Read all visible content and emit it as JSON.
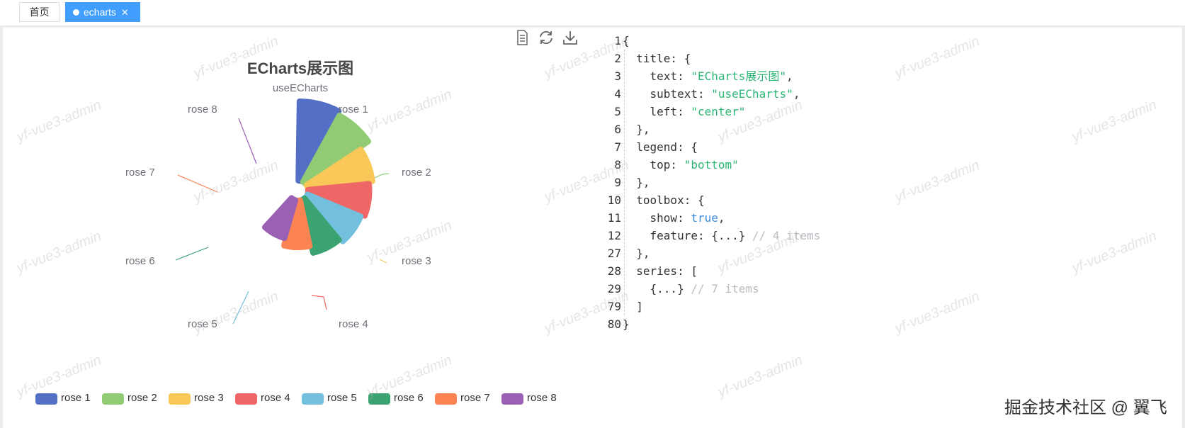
{
  "tabs": [
    {
      "label": "首页",
      "active": false
    },
    {
      "label": "echarts",
      "active": true
    }
  ],
  "chart": {
    "title": "ECharts展示图",
    "subtitle": "useECharts",
    "toolbox": [
      "data-view-icon",
      "restore-icon",
      "save-as-image-icon"
    ]
  },
  "chart_data": {
    "type": "pie",
    "roseType": "radius",
    "title": "ECharts展示图",
    "subtitle": "useECharts",
    "legend_position": "bottom",
    "categories": [
      "rose 1",
      "rose 2",
      "rose 3",
      "rose 4",
      "rose 5",
      "rose 6",
      "rose 7",
      "rose 8"
    ],
    "values": [
      40,
      38,
      32,
      30,
      28,
      26,
      22,
      18
    ],
    "colors": [
      "#5470c6",
      "#91cc75",
      "#fac858",
      "#ee6666",
      "#73c0de",
      "#3ba272",
      "#fc8452",
      "#9a60b4"
    ]
  },
  "code": {
    "lines": [
      {
        "num": "1",
        "tokens": [
          {
            "t": "{",
            "c": "key"
          }
        ],
        "indent": 0
      },
      {
        "num": "2",
        "tokens": [
          {
            "t": "title: {",
            "c": "key"
          }
        ],
        "indent": 1
      },
      {
        "num": "3",
        "tokens": [
          {
            "t": "text: ",
            "c": "key"
          },
          {
            "t": "\"ECharts展示图\"",
            "c": "str"
          },
          {
            "t": ",",
            "c": "key"
          }
        ],
        "indent": 2
      },
      {
        "num": "4",
        "tokens": [
          {
            "t": "subtext: ",
            "c": "key"
          },
          {
            "t": "\"useECharts\"",
            "c": "str"
          },
          {
            "t": ",",
            "c": "key"
          }
        ],
        "indent": 2
      },
      {
        "num": "5",
        "tokens": [
          {
            "t": "left: ",
            "c": "key"
          },
          {
            "t": "\"center\"",
            "c": "str"
          }
        ],
        "indent": 2
      },
      {
        "num": "6",
        "tokens": [
          {
            "t": "},",
            "c": "key"
          }
        ],
        "indent": 1
      },
      {
        "num": "7",
        "tokens": [
          {
            "t": "legend: {",
            "c": "key"
          }
        ],
        "indent": 1
      },
      {
        "num": "8",
        "tokens": [
          {
            "t": "top: ",
            "c": "key"
          },
          {
            "t": "\"bottom\"",
            "c": "str"
          }
        ],
        "indent": 2
      },
      {
        "num": "9",
        "tokens": [
          {
            "t": "},",
            "c": "key"
          }
        ],
        "indent": 1
      },
      {
        "num": "10",
        "tokens": [
          {
            "t": "toolbox: {",
            "c": "key"
          }
        ],
        "indent": 1
      },
      {
        "num": "11",
        "tokens": [
          {
            "t": "show: ",
            "c": "key"
          },
          {
            "t": "true",
            "c": "bool"
          },
          {
            "t": ",",
            "c": "key"
          }
        ],
        "indent": 2
      },
      {
        "num": "12",
        "tokens": [
          {
            "t": "feature: {...} ",
            "c": "key"
          },
          {
            "t": "// 4 items",
            "c": "cmt"
          }
        ],
        "indent": 2
      },
      {
        "num": "27",
        "tokens": [
          {
            "t": "},",
            "c": "key"
          }
        ],
        "indent": 1
      },
      {
        "num": "28",
        "tokens": [
          {
            "t": "series: [",
            "c": "key"
          }
        ],
        "indent": 1
      },
      {
        "num": "29",
        "tokens": [
          {
            "t": "{...} ",
            "c": "key"
          },
          {
            "t": "// 7 items",
            "c": "cmt"
          }
        ],
        "indent": 2
      },
      {
        "num": "79",
        "tokens": [
          {
            "t": "]",
            "c": "key"
          }
        ],
        "indent": 1
      },
      {
        "num": "80",
        "tokens": [
          {
            "t": "}",
            "c": "key"
          }
        ],
        "indent": 0
      }
    ]
  },
  "watermark": "yf-vue3-admin",
  "attribution": "掘金技术社区 @ 翼飞"
}
